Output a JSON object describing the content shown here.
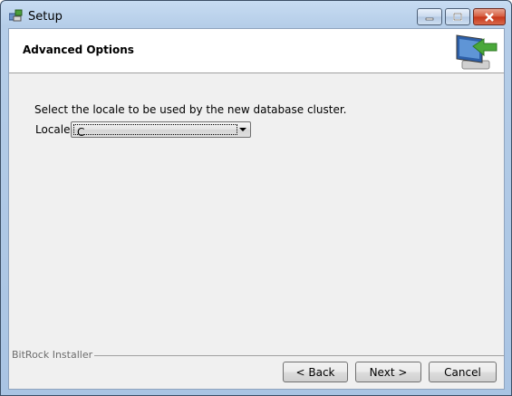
{
  "window": {
    "title": "Setup"
  },
  "header": {
    "title": "Advanced Options"
  },
  "main": {
    "prompt": "Select the locale to be used by the new database cluster.",
    "locale_label": "Locale",
    "locale_value": "C"
  },
  "footer": {
    "brand": "BitRock Installer",
    "back_label": "< Back",
    "next_label": "Next >",
    "cancel_label": "Cancel"
  },
  "icons": {
    "app": "setup-app-icon",
    "header_logo": "computer-monitor-arrow-icon",
    "minimize": "minimize-icon",
    "maximize": "maximize-icon",
    "close": "close-icon",
    "dropdown": "chevron-down-icon"
  }
}
